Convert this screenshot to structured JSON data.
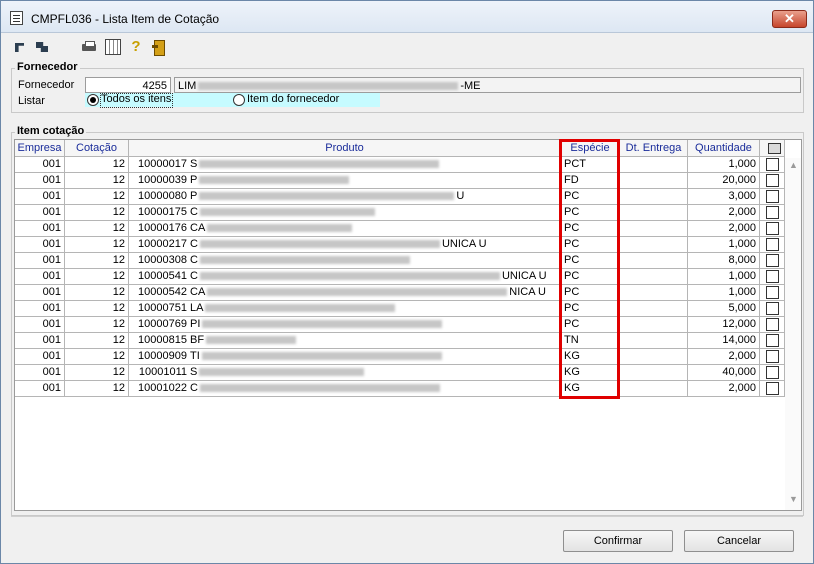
{
  "window": {
    "title": "CMPFL036 - Lista Item de Cotação",
    "close_label": "✕"
  },
  "toolbar": {
    "icons": [
      "sort-icon",
      "group-icon",
      "print-icon",
      "grid-icon",
      "help-icon",
      "exit-icon"
    ]
  },
  "fornecedor": {
    "section_title": "Fornecedor",
    "field_label": "Fornecedor",
    "code": "4255",
    "name_prefix": "LIM",
    "name_suffix": "-ME",
    "listar_label": "Listar",
    "options": [
      {
        "label": "Todos os itens",
        "selected": true
      },
      {
        "label": "Item do fornecedor",
        "selected": false
      }
    ]
  },
  "items": {
    "section_title": "Item cotação",
    "columns": [
      "Empresa",
      "Cotação",
      "Produto",
      "Espécie",
      "Dt. Entrega",
      "Quantidade"
    ],
    "rows": [
      {
        "empresa": "001",
        "cotacao": "12",
        "codigo": "10000017",
        "inicial": "S",
        "tail": "",
        "especie": "PCT",
        "entrega": "",
        "quantidade": "1,000"
      },
      {
        "empresa": "001",
        "cotacao": "12",
        "codigo": "10000039",
        "inicial": "P",
        "tail": "",
        "especie": "FD",
        "entrega": "",
        "quantidade": "20,000"
      },
      {
        "empresa": "001",
        "cotacao": "12",
        "codigo": "10000080",
        "inicial": "P",
        "tail": "U",
        "especie": "PC",
        "entrega": "",
        "quantidade": "3,000"
      },
      {
        "empresa": "001",
        "cotacao": "12",
        "codigo": "10000175",
        "inicial": "C",
        "tail": "",
        "especie": "PC",
        "entrega": "",
        "quantidade": "2,000"
      },
      {
        "empresa": "001",
        "cotacao": "12",
        "codigo": "10000176",
        "inicial": "CA",
        "tail": "",
        "especie": "PC",
        "entrega": "",
        "quantidade": "2,000"
      },
      {
        "empresa": "001",
        "cotacao": "12",
        "codigo": "10000217",
        "inicial": "C",
        "tail": "UNICA U",
        "especie": "PC",
        "entrega": "",
        "quantidade": "1,000"
      },
      {
        "empresa": "001",
        "cotacao": "12",
        "codigo": "10000308",
        "inicial": "C",
        "tail": "",
        "especie": "PC",
        "entrega": "",
        "quantidade": "8,000"
      },
      {
        "empresa": "001",
        "cotacao": "12",
        "codigo": "10000541",
        "inicial": "C",
        "tail": "UNICA U",
        "especie": "PC",
        "entrega": "",
        "quantidade": "1,000"
      },
      {
        "empresa": "001",
        "cotacao": "12",
        "codigo": "10000542",
        "inicial": "CA",
        "tail": "NICA U",
        "especie": "PC",
        "entrega": "",
        "quantidade": "1,000"
      },
      {
        "empresa": "001",
        "cotacao": "12",
        "codigo": "10000751",
        "inicial": "LA",
        "tail": "",
        "especie": "PC",
        "entrega": "",
        "quantidade": "5,000"
      },
      {
        "empresa": "001",
        "cotacao": "12",
        "codigo": "10000769",
        "inicial": "PI",
        "tail": "",
        "especie": "PC",
        "entrega": "",
        "quantidade": "12,000"
      },
      {
        "empresa": "001",
        "cotacao": "12",
        "codigo": "10000815",
        "inicial": "BF",
        "tail": "",
        "especie": "TN",
        "entrega": "",
        "quantidade": "14,000"
      },
      {
        "empresa": "001",
        "cotacao": "12",
        "codigo": "10000909",
        "inicial": "TI",
        "tail": "",
        "especie": "KG",
        "entrega": "",
        "quantidade": "2,000"
      },
      {
        "empresa": "001",
        "cotacao": "12",
        "codigo": "10001011",
        "inicial": "S",
        "tail": "",
        "especie": "KG",
        "entrega": "",
        "quantidade": "40,000"
      },
      {
        "empresa": "001",
        "cotacao": "12",
        "codigo": "10001022",
        "inicial": "C",
        "tail": "",
        "especie": "KG",
        "entrega": "",
        "quantidade": "2,000"
      }
    ]
  },
  "buttons": {
    "confirm": "Confirmar",
    "cancel": "Cancelar"
  }
}
